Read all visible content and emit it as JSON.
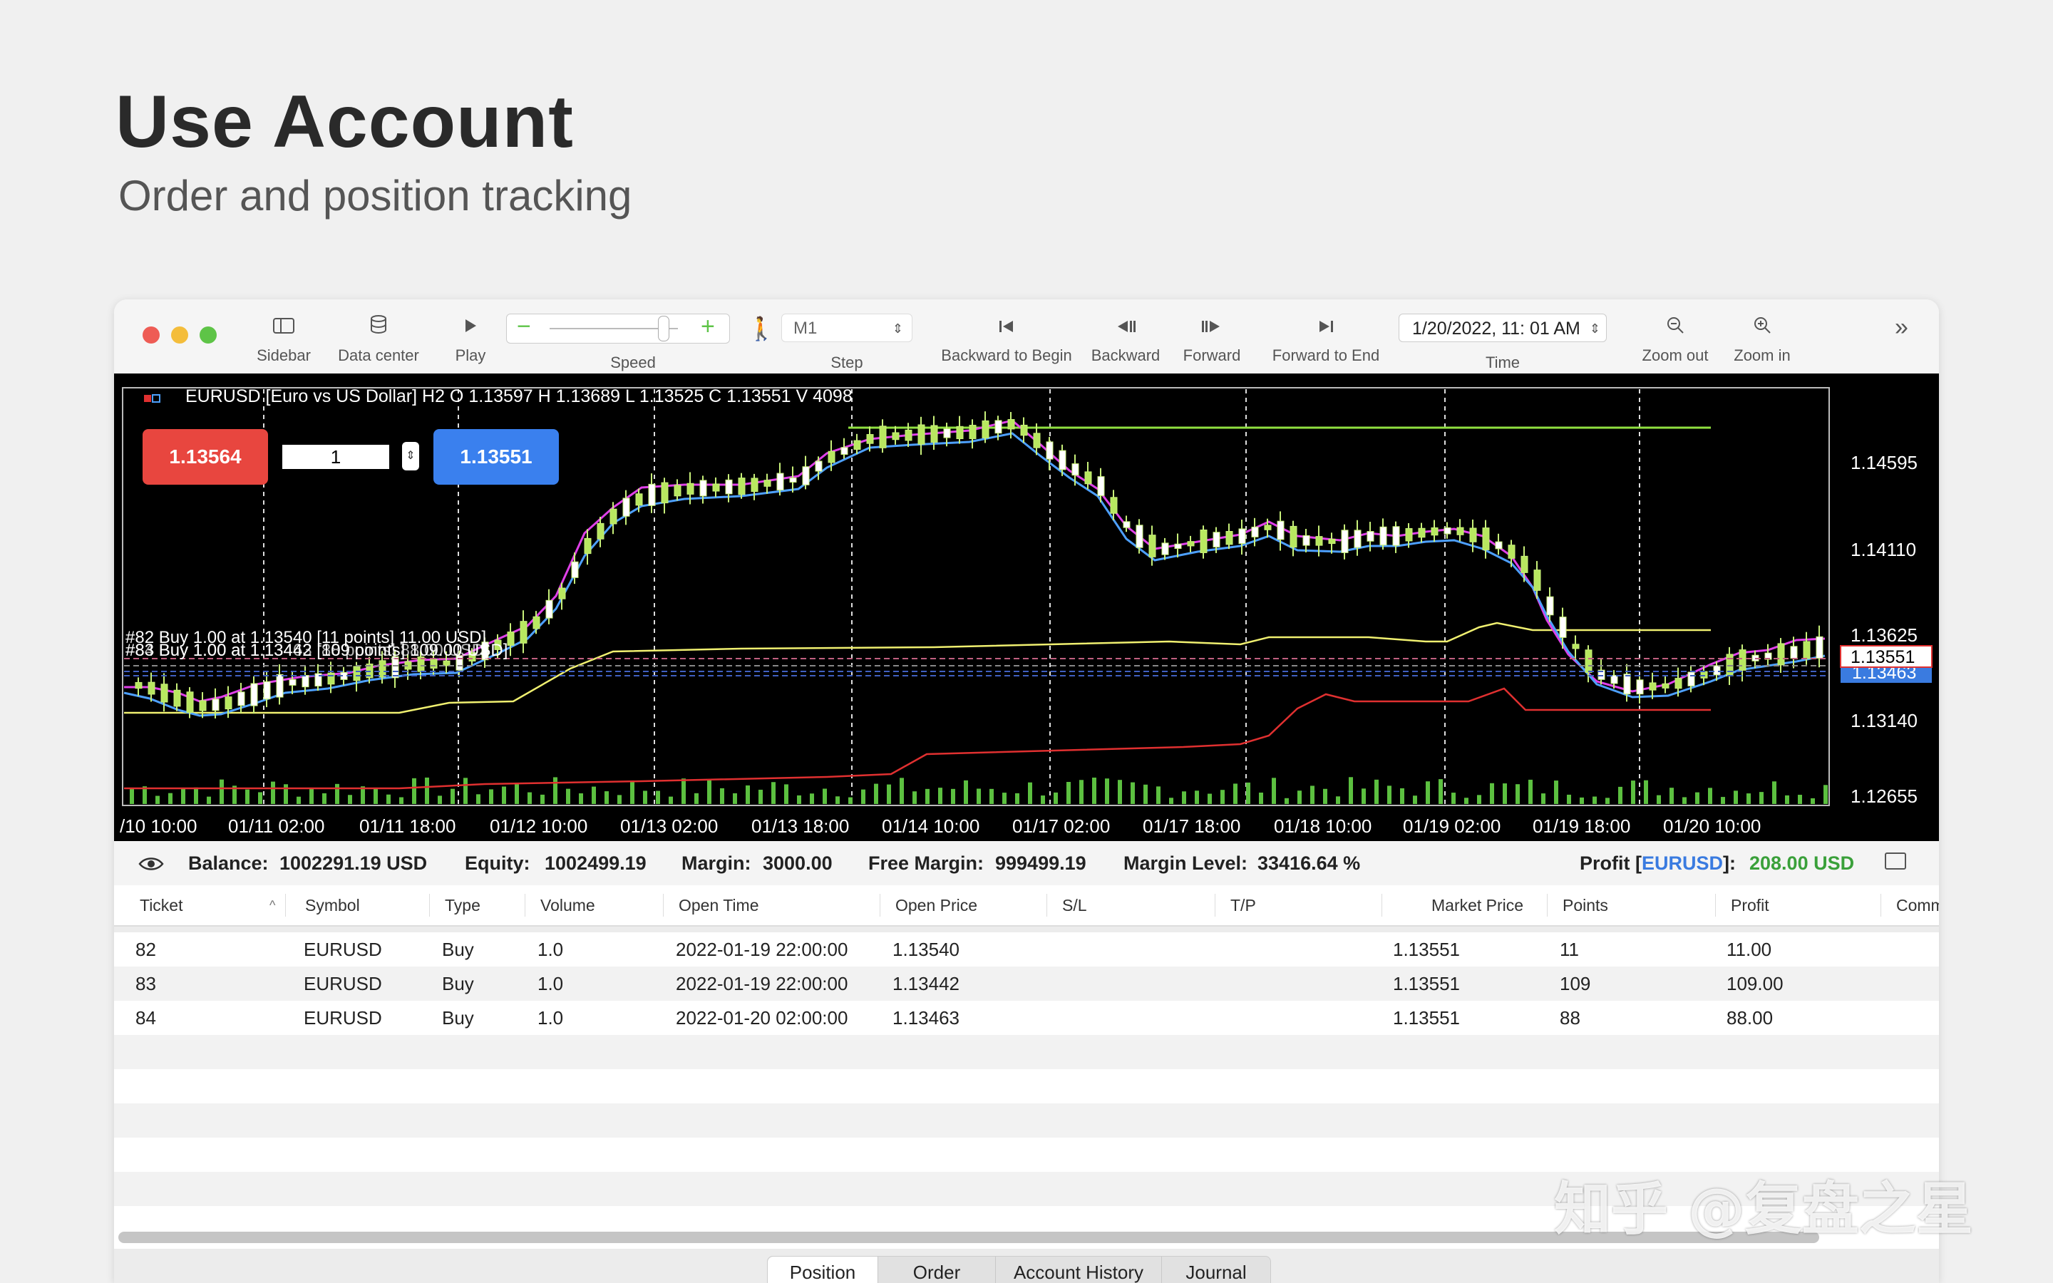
{
  "hero": {
    "title": "Use Account",
    "subtitle": "Order and position tracking"
  },
  "toolbar": {
    "sidebar": "Sidebar",
    "data_center": "Data center",
    "play": "Play",
    "speed": "Speed",
    "step_value": "M1",
    "step": "Step",
    "backward_to_begin": "Backward to Begin",
    "backward": "Backward",
    "forward": "Forward",
    "forward_to_end": "Forward to End",
    "time_value": "1/20/2022, 11: 01 AM",
    "time": "Time",
    "zoom_out": "Zoom out",
    "zoom_in": "Zoom in"
  },
  "chart": {
    "header": "EURUSD [Euro vs US Dollar]  H2  O  1.13597  H  1.13689  L  1.13525  C  1.13551  V  4098",
    "sell_price": "1.13564",
    "lot": "1",
    "buy_price": "1.13551",
    "order_lines": [
      "#82 Buy 1.00 at 1.13540 [11 points] 11.00 USD]",
      "#83 Buy 1.00 at 1.13442 [109 points] 109.00 USD]",
      "#84 Buy 1.00 at 1.13463 [88 points] 88.00 USD]"
    ],
    "price_ticks": [
      "1.14595",
      "1.14110",
      "1.13625",
      "1.13140",
      "1.12655"
    ],
    "current_price": "1.13551",
    "line_price": "1.13463",
    "time_ticks": [
      "/10 10:00",
      "01/11 02:00",
      "01/11 18:00",
      "01/12 10:00",
      "01/13 02:00",
      "01/13 18:00",
      "01/14 10:00",
      "01/17 02:00",
      "01/17 18:00",
      "01/18 10:00",
      "01/19 02:00",
      "01/19 18:00",
      "01/20 10:00"
    ],
    "colors": {
      "up": "#c8f07a",
      "magenta": "#e040e8",
      "blue": "#4da0ff",
      "yellow": "#f0f070",
      "red": "#e03030",
      "green_line": "#90e040"
    }
  },
  "status": {
    "balance_label": "Balance:",
    "balance": "1002291.19 USD",
    "equity_label": "Equity:",
    "equity": "1002499.19",
    "margin_label": "Margin:",
    "margin": "3000.00",
    "free_margin_label": "Free Margin:",
    "free_margin": "999499.19",
    "margin_level_label": "Margin Level:",
    "margin_level": "33416.64 %",
    "profit_label": "Profit [",
    "profit_symbol": "EURUSD",
    "profit_close": "]:",
    "profit": "208.00 USD"
  },
  "table": {
    "columns": [
      "Ticket",
      "Symbol",
      "Type",
      "Volume",
      "Open Time",
      "Open Price",
      "S/L",
      "T/P",
      "Market Price",
      "Points",
      "Profit",
      "Comm"
    ],
    "rows": [
      {
        "ticket": "82",
        "symbol": "EURUSD",
        "type": "Buy",
        "volume": "1.0",
        "open_time": "2022-01-19 22:00:00",
        "open_price": "1.13540",
        "market_price": "1.13551",
        "points": "11",
        "profit": "11.00"
      },
      {
        "ticket": "83",
        "symbol": "EURUSD",
        "type": "Buy",
        "volume": "1.0",
        "open_time": "2022-01-19 22:00:00",
        "open_price": "1.13442",
        "market_price": "1.13551",
        "points": "109",
        "profit": "109.00"
      },
      {
        "ticket": "84",
        "symbol": "EURUSD",
        "type": "Buy",
        "volume": "1.0",
        "open_time": "2022-01-20 02:00:00",
        "open_price": "1.13463",
        "market_price": "1.13551",
        "points": "88",
        "profit": "88.00"
      }
    ]
  },
  "tabs": [
    "Position",
    "Order",
    "Account History",
    "Journal"
  ],
  "watermark": "知乎 @复盘之星"
}
